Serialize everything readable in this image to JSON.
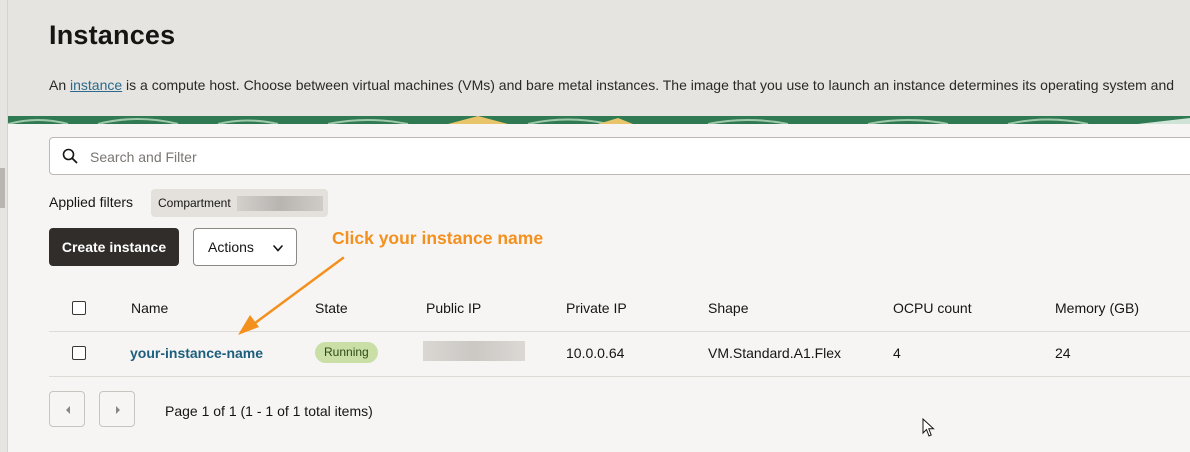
{
  "page": {
    "title": "Instances",
    "description_before_link": "An ",
    "description_link": "instance",
    "description_after_link": " is a compute host. Choose between virtual machines (VMs) and bare metal instances. The image that you use to launch an instance determines its operating system and"
  },
  "search": {
    "placeholder": "Search and Filter",
    "value": ""
  },
  "filters": {
    "label": "Applied filters",
    "chips": [
      {
        "label": "Compartment",
        "value_redacted": true
      }
    ]
  },
  "toolbar": {
    "create_label": "Create instance",
    "actions_label": "Actions"
  },
  "annotation": {
    "text": "Click your instance name",
    "color": "#f4901e"
  },
  "table": {
    "columns": [
      "Name",
      "State",
      "Public IP",
      "Private IP",
      "Shape",
      "OCPU count",
      "Memory (GB)"
    ],
    "rows": [
      {
        "name": "your-instance-name",
        "state": "Running",
        "public_ip_redacted": true,
        "private_ip": "10.0.0.64",
        "shape": "VM.Standard.A1.Flex",
        "ocpu": "4",
        "memory": "24"
      }
    ]
  },
  "pagination": {
    "text": "Page 1 of 1 (1 - 1 of 1 total items)"
  },
  "colors": {
    "link": "#1d5e7e",
    "status_running": "#c9dfa6",
    "primary_button": "#312d2a"
  }
}
